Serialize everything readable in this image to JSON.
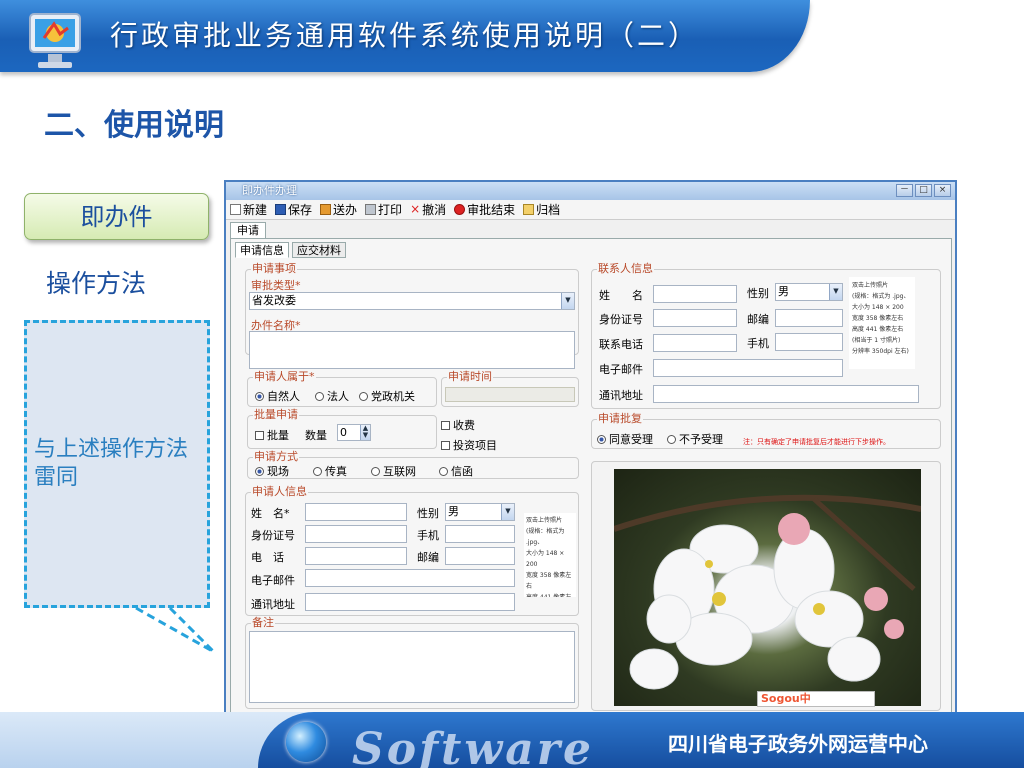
{
  "header": {
    "title": "行政审批业务通用软件系统使用说明（二）",
    "section_title": "二、使用说明"
  },
  "sidebar": {
    "badge": "即办件",
    "method": "操作方法",
    "callout": "与上述操作方法雷同"
  },
  "footer": {
    "org": "四川省电子政务外网运营中心",
    "watermark": "Software"
  },
  "window": {
    "title": "即办件办理",
    "controls": [
      "－",
      "□",
      "×"
    ],
    "toolbar": {
      "new": "新建",
      "save": "保存",
      "send": "送办",
      "print": "打印",
      "cancel": "撤消",
      "end": "审批结束",
      "archive": "归档"
    },
    "outer_tab": "申请",
    "tabs": [
      "申请信息",
      "应交材料"
    ]
  },
  "form": {
    "item_group": "申请事项",
    "approval_type_label": "审批类型*",
    "approval_type_value": "省发改委",
    "case_name_label": "办件名称*",
    "applicant_type_label": "申请人属于*",
    "applicant_types": [
      "自然人",
      "法人",
      "党政机关"
    ],
    "apply_time_label": "申请时间",
    "batch_label": "批量申请",
    "batch_check": "批量",
    "qty_label": "数量",
    "qty_value": "0",
    "fee_label": "收费",
    "invest_label": "投资项目",
    "method_label": "申请方式",
    "methods": [
      "现场",
      "传真",
      "互联网",
      "信函"
    ],
    "applicant_group": "申请人信息",
    "name_label": "姓　名*",
    "gender_label": "性别",
    "gender_value": "男",
    "id_label": "身份证号",
    "mobile_label": "手机",
    "phone_label": "电　话",
    "postcode_label": "邮编",
    "email_label": "电子邮件",
    "address_label": "通讯地址",
    "remark_label": "备注",
    "contact_group": "联系人信息",
    "contact_name_label": "姓　　名",
    "contact_gender_label": "性别",
    "contact_gender_value": "男",
    "contact_id_label": "身份证号",
    "contact_postcode_label": "邮编",
    "contact_phone_label": "联系电话",
    "contact_mobile_label": "手机",
    "contact_email_label": "电子邮件",
    "contact_address_label": "通讯地址",
    "reply_group": "申请批复",
    "reply_options": [
      "同意受理",
      "不予受理"
    ],
    "reply_note": "注：只有确定了申请批复后才能进行下步操作。",
    "photo_note_lines": [
      "双击上传照片",
      "(规格：格式为 .jpg、",
      "大小为 148 × 200",
      "宽度 358 像素左右",
      "高度 441 像素左右",
      "(相当于 1 寸照片)",
      "分辨率 350dpi 左右)"
    ],
    "ime_text": "Sogou中"
  }
}
